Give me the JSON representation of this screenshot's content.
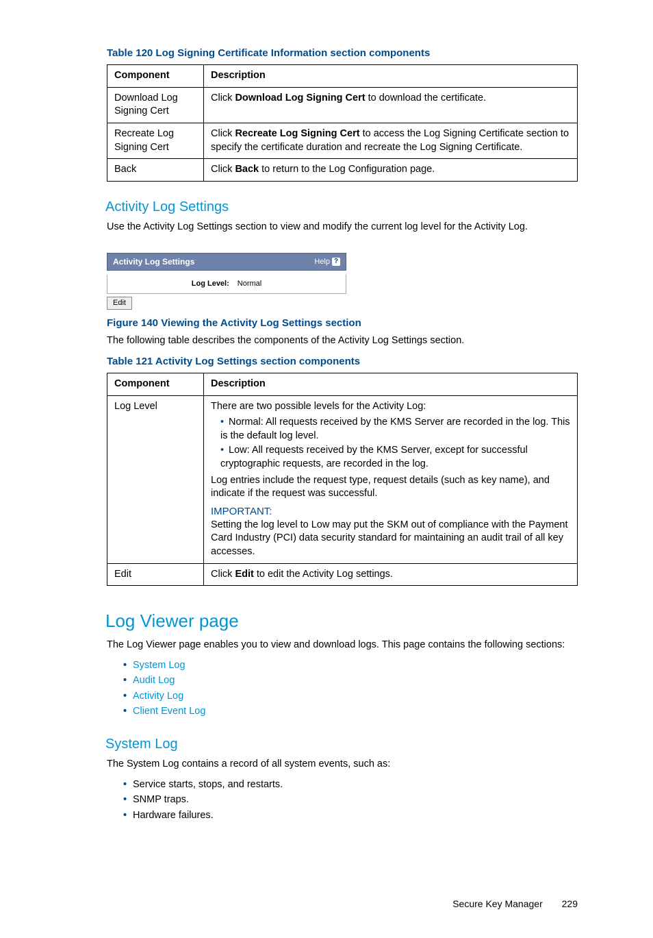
{
  "table120": {
    "caption": "Table 120 Log Signing Certificate Information section components",
    "headers": [
      "Component",
      "Description"
    ],
    "rows": [
      {
        "component": "Download Log Signing Cert",
        "desc_pre": "Click ",
        "desc_bold": "Download Log Signing Cert",
        "desc_post": " to download the certificate."
      },
      {
        "component": "Recreate Log Signing Cert",
        "desc_pre": "Click ",
        "desc_bold": "Recreate Log Signing Cert",
        "desc_post": " to access the Log Signing Certificate section to specify the certificate duration and recreate the Log Signing Certificate."
      },
      {
        "component": "Back",
        "desc_pre": "Click ",
        "desc_bold": "Back",
        "desc_post": " to return to the Log Configuration page."
      }
    ]
  },
  "activity_settings": {
    "heading": "Activity Log Settings",
    "intro": "Use the Activity Log Settings section to view and modify the current log level for the Activity Log.",
    "widget": {
      "title": "Activity Log Settings",
      "help_label": "Help",
      "help_icon": "?",
      "row_label": "Log Level:",
      "row_value": "Normal",
      "button": "Edit"
    },
    "figure_caption": "Figure 140 Viewing the Activity Log Settings section",
    "after_figure": "The following table describes the components of the Activity Log Settings section."
  },
  "table121": {
    "caption": "Table 121 Activity Log Settings section components",
    "headers": [
      "Component",
      "Description"
    ],
    "row_loglevel": {
      "component": "Log Level",
      "intro": "There are two possible levels for the Activity Log:",
      "bullets": [
        "Normal: All requests received by the KMS Server are recorded in the log. This is the default log level.",
        "Low: All requests received by the KMS Server, except for successful cryptographic requests, are recorded in the log."
      ],
      "middle": "Log entries include the request type, request details (such as key name), and indicate if the request was successful.",
      "important_label": "IMPORTANT:",
      "important_text": "Setting the log level to Low may put the SKM out of compliance with the Payment Card Industry (PCI) data security standard for maintaining an audit trail of all key accesses."
    },
    "row_edit": {
      "component": "Edit",
      "desc_pre": "Click ",
      "desc_bold": "Edit",
      "desc_post": " to edit the Activity Log settings."
    }
  },
  "log_viewer": {
    "heading": "Log Viewer page",
    "intro": "The Log Viewer page enables you to view and download logs. This page contains the following sections:",
    "links": [
      "System Log",
      "Audit Log",
      "Activity Log",
      "Client Event Log"
    ]
  },
  "system_log": {
    "heading": "System Log",
    "intro": "The System Log contains a record of all system events, such as:",
    "items": [
      "Service starts, stops, and restarts.",
      "SNMP traps.",
      "Hardware failures."
    ]
  },
  "footer": {
    "title": "Secure Key Manager",
    "page": "229"
  }
}
